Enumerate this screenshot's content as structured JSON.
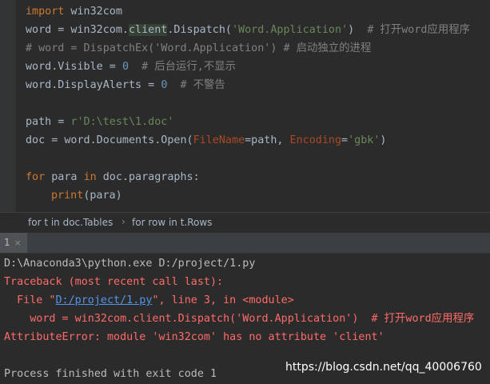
{
  "editor": {
    "l1": {
      "kw": "import",
      "rest": " win32com"
    },
    "l2": {
      "a": "word = win32com.",
      "hl": "client",
      "b": ".Dispatch(",
      "s": "'Word.Application'",
      "c": ")  ",
      "cm": "# 打开word应用程序"
    },
    "l3": {
      "cm": "# word = DispatchEx('Word.Application') # 启动独立的进程"
    },
    "l4": {
      "a": "word.Visible = ",
      "n": "0",
      "c": "  ",
      "cm": "# 后台运行,不显示"
    },
    "l5": {
      "a": "word.DisplayAlerts = ",
      "n": "0",
      "c": "  ",
      "cm": "# 不警告"
    },
    "l7": {
      "a": "path = ",
      "s": "r'D:\\test\\1.doc'"
    },
    "l8": {
      "a": "doc = word.Documents.Open(",
      "p1": "FileName",
      "b": "=path, ",
      "p2": "Encoding",
      "c": "=",
      "s": "'gbk'",
      "d": ")"
    },
    "l10": {
      "kw1": "for",
      "a": " para ",
      "kw2": "in",
      "b": " doc.paragraphs:"
    },
    "l11": {
      "kw": "print",
      "a": "(para)"
    }
  },
  "breadcrumbs": {
    "first": "for t in doc.Tables",
    "sep": "›",
    "second": "for row in t.Rows"
  },
  "run_tab": {
    "label": "1",
    "close": "×"
  },
  "console": {
    "cmd": "D:\\Anaconda3\\python.exe D:/project/1.py",
    "traceback": "Traceback (most recent call last):",
    "file_pre": "  File \"",
    "file_link": "D:/project/1.py",
    "file_post": "\", line 3, in <module>",
    "code_line": "    word = win32com.client.Dispatch('Word.Application')  # 打开word应用程序",
    "error": "AttributeError: module 'win32com' has no attribute 'client'",
    "finished": "Process finished with exit code 1"
  },
  "watermark": "https://blog.csdn.net/qq_40006760"
}
